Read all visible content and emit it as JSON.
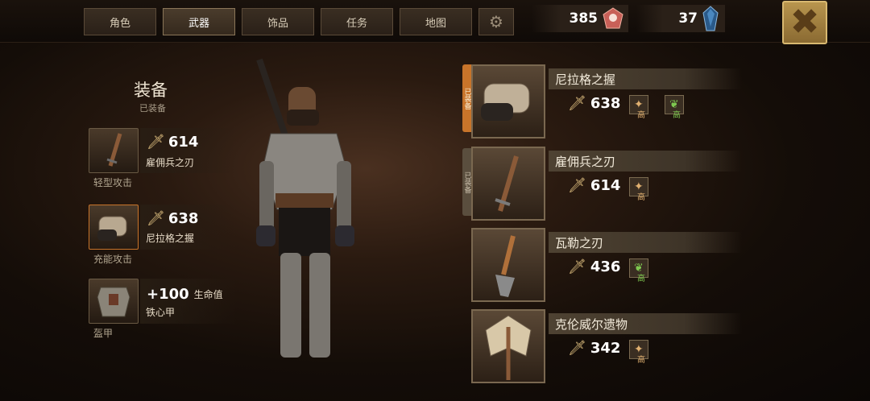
{
  "tabs": [
    "角色",
    "武器",
    "饰品",
    "任务",
    "地图"
  ],
  "active_tab": "武器",
  "resources": {
    "crystals": "385",
    "gems": "37"
  },
  "equipment": {
    "title": "装备",
    "subtitle": "已装备",
    "slots": [
      {
        "value": "614",
        "name": "雇佣兵之刃",
        "label": "轻型攻击"
      },
      {
        "value": "638",
        "name": "尼拉格之握",
        "label": "充能攻击"
      },
      {
        "value": "+100",
        "unit": "生命值",
        "name": "铁心甲",
        "label": "盔甲"
      }
    ]
  },
  "inventory": [
    {
      "name": "尼拉格之握",
      "value": "638",
      "equipped_tag": "已装备",
      "badges": [
        {
          "icon": "claw-icon",
          "label": "高"
        },
        {
          "icon": "leaf-icon",
          "label": "高"
        }
      ]
    },
    {
      "name": "雇佣兵之刃",
      "value": "614",
      "equipped_tag": "已装备",
      "badges": [
        {
          "icon": "claw-icon",
          "label": "高"
        }
      ]
    },
    {
      "name": "瓦勒之刃",
      "value": "436",
      "badges": [
        {
          "icon": "leaf-icon",
          "label": "高"
        }
      ]
    },
    {
      "name": "克伦威尔遗物",
      "value": "342",
      "badges": [
        {
          "icon": "claw-icon",
          "label": "高"
        }
      ]
    }
  ],
  "colors": {
    "equipped_orange": "#c8742a",
    "badge_claw": "#e0b070",
    "badge_leaf": "#7ec850"
  }
}
